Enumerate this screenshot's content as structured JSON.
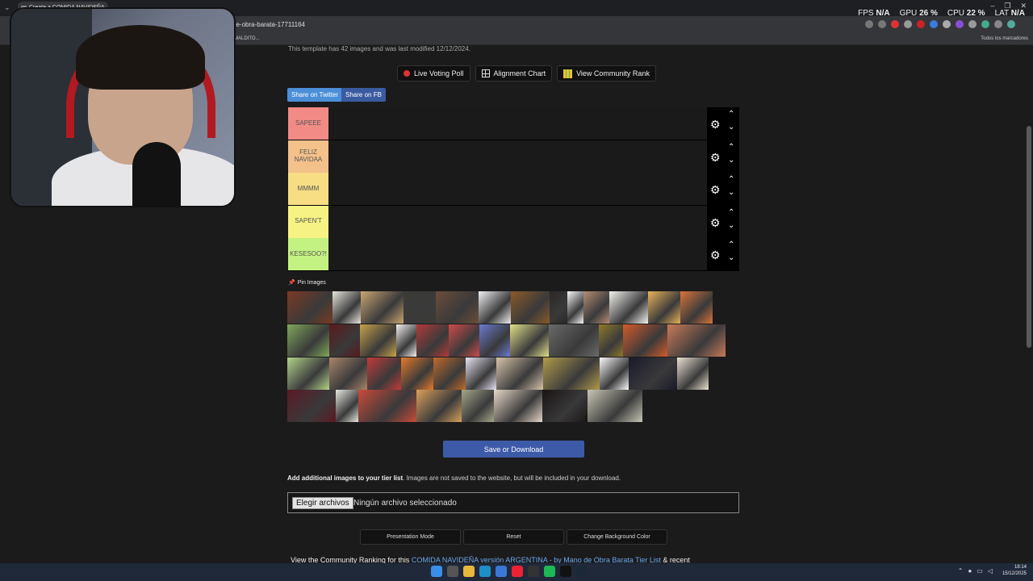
{
  "browser": {
    "tab_title": "Create a COMIDA NAVIDEÑA",
    "url": "de-obra-barata-17711164",
    "bookmark": "MALDITO...",
    "bookmarks_all": "Todos los marcadores"
  },
  "overlay": {
    "fps_label": "FPS",
    "fps_value": "N/A",
    "gpu_label": "GPU",
    "gpu_value": "26 %",
    "cpu_label": "CPU",
    "cpu_value": "22 %",
    "lat_label": "LAT",
    "lat_value": "N/A"
  },
  "page": {
    "template_note": "This template has 42 images and was last modified 12/12/2024.",
    "buttons": {
      "live_poll": "Live Voting Poll",
      "alignment": "Alignment Chart",
      "community_rank": "View Community Rank"
    },
    "share": {
      "twitter": "Share on Twitter",
      "facebook": "Share on FB"
    },
    "tiers": [
      {
        "label": "SAPEEE",
        "color": "#f28b86"
      },
      {
        "label": "FELIZ NAVIDAA",
        "color": "#f4c18b"
      },
      {
        "label": "MMMM",
        "color": "#f7dd84"
      },
      {
        "label": "SAPEN'T",
        "color": "#f6f384"
      },
      {
        "label": "KESESOO?!",
        "color": "#c4f282"
      }
    ],
    "pin_label": "Pin Images",
    "save_button": "Save or Download",
    "add_bold": "Add additional images to your tier list",
    "add_rest": ". Images are not saved to the website, but will be included in your download.",
    "file_button": "Elegir archivos",
    "file_status": "Ningún archivo seleccionado",
    "bottom_buttons": [
      "Presentation Mode",
      "Reset",
      "Change Background Color"
    ],
    "cutoff_text_a": "View the Community Ranking for this ",
    "cutoff_link": "COMIDA NAVIDEÑA versión ARGENTINA - by Mano de Obra Barata Tier List",
    "cutoff_text_b": " & recent"
  },
  "taskbar": {
    "time": "18:14",
    "date": "15/12/2025"
  }
}
